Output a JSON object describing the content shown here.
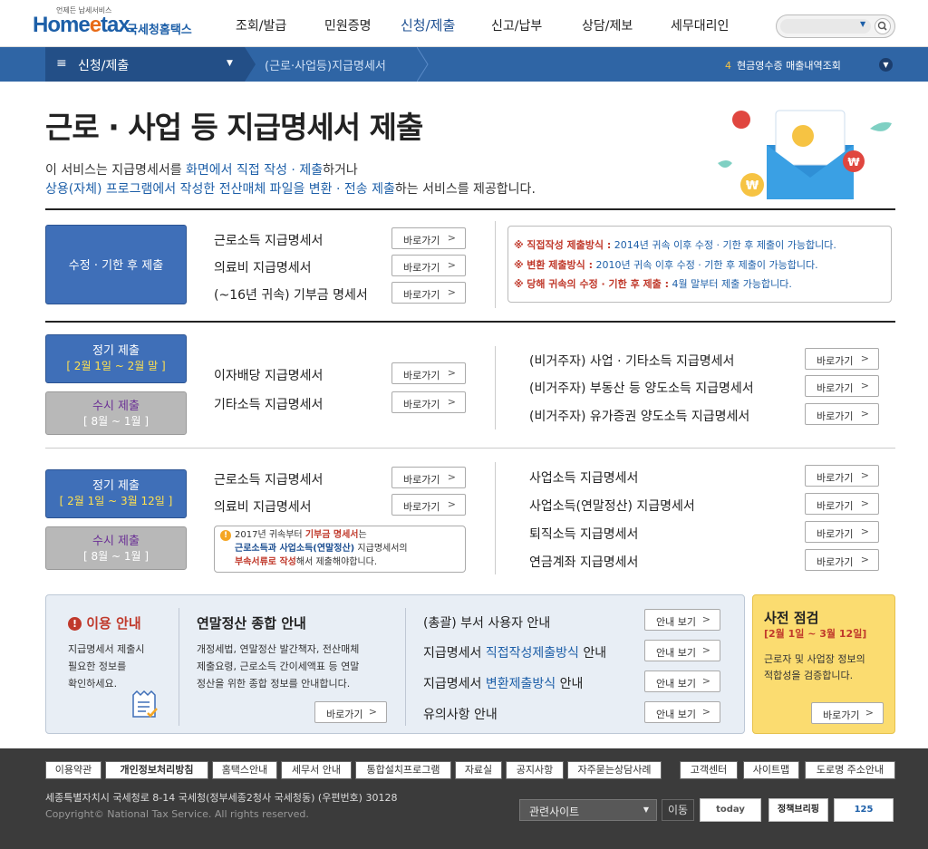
{
  "header": {
    "logo_tag": "언제든 납세서비스",
    "logo_main": "Home",
    "logo_e": "e",
    "logo_tail": "tax.",
    "logo_ko": "국세청홈택스",
    "gnb": [
      "조회/발급",
      "민원증명",
      "신청/제출",
      "신고/납부",
      "상담/제보",
      "세무대리인"
    ]
  },
  "subnav": {
    "menu_label": "신청/제출",
    "breadcrumb": "(근로·사업등)지급명세서",
    "right_num": "4",
    "right_text": "현금영수증 매출내역조회"
  },
  "page": {
    "title": "근로 · 사업 등 지급명세서 제출",
    "intro1_a": "이 서비스는 지급명세서를 ",
    "intro1_b": "화면에서 직접 작성 · 제출",
    "intro1_c": "하거나",
    "intro2_a": "상용(자체) 프로그램에서 작성한 전산매체 파일을 변환 · 전송 제출",
    "intro2_b": "하는 서비스를 제공합니다."
  },
  "go_label": "바로가기",
  "arrow": ">",
  "section1": {
    "box": "수정 · 기한 후 제출",
    "items": [
      "근로소득 지급명세서",
      "의료비 지급명세서",
      "(~16년 귀속) 기부금 명세서"
    ],
    "notices": [
      {
        "mark": "※",
        "label": "직접작성 제출방식 :",
        "text": "2014년 귀속 이후 수정 · 기한 후 제출이 가능합니다."
      },
      {
        "mark": "※",
        "label": "변환 제출방식 :",
        "text": "2010년 귀속 이후 수정 · 기한 후 제출이 가능합니다."
      },
      {
        "mark": "※",
        "label": "당해 귀속의 수정 · 기한 후 제출 :",
        "text": "4월 말부터 제출 가능합니다."
      }
    ]
  },
  "section2": {
    "regular": "정기 제출",
    "regular_period": "[ 2월 1일 ~ 2월 말 ]",
    "adhoc": "수시 제출",
    "adhoc_period": "[ 8월 ~ 1월 ]",
    "items_left": [
      "이자배당 지급명세서",
      "기타소득 지급명세서"
    ],
    "items_right": [
      "(비거주자) 사업 · 기타소득 지급명세서",
      "(비거주자) 부동산 등 양도소득 지급명세서",
      "(비거주자) 유가증권 양도소득 지급명세서"
    ]
  },
  "section3": {
    "regular": "정기 제출",
    "regular_period": "[ 2월 1일 ~ 3월 12일 ]",
    "adhoc": "수시 제출",
    "adhoc_period": "[ 8월 ~ 1월 ]",
    "items_left": [
      "근로소득 지급명세서",
      "의료비 지급명세서"
    ],
    "items_right": [
      "사업소득 지급명세서",
      "사업소득(연말정산) 지급명세서",
      "퇴직소득 지급명세서",
      "연금계좌 지급명세서"
    ],
    "notice": {
      "icon": "!",
      "a": "2017년 귀속부터 ",
      "b": "기부금 명세서",
      "c": "는",
      "d": "근로소득과 사업소득(연말정산)",
      "e": " 지급명세서의",
      "f": "부속서류로 작성",
      "g": "해서 제출해야합니다."
    }
  },
  "info": {
    "usage_title": "이용 안내",
    "usage_icon": "!",
    "usage_text": [
      "지급명세서 제출시",
      "필요한 정보를",
      "확인하세요."
    ],
    "yearend_title": "연말정산 종합 안내",
    "yearend_text": [
      "개정세법, 연말정산 발간책자, 전산매체",
      "제출요령, 근로소득 간이세액표 등 연말",
      "정산을 위한 종합 정보를 안내합니다."
    ],
    "yearend_btn": "바로가기",
    "guides": [
      {
        "a": "(총괄) 부서 사용자 안내",
        "b": "",
        "c": ""
      },
      {
        "a": "지급명세서 ",
        "b": "직접작성제출방식",
        "c": " 안내"
      },
      {
        "a": "지급명세서 ",
        "b": "변환제출방식",
        "c": " 안내"
      },
      {
        "a": "유의사항 안내",
        "b": "",
        "c": ""
      }
    ],
    "guide_btn": "안내 보기"
  },
  "precheck": {
    "title": "사전 점검",
    "period": "[2월 1일 ~ 3월 12일]",
    "text": [
      "근로자 및 사업장 정보의",
      "적합성을 검증합니다."
    ],
    "btn": "바로가기"
  },
  "footer": {
    "links": [
      "이용약관",
      "개인정보처리방침",
      "홈택스안내",
      "세무서 안내",
      "통합설치프로그램",
      "자료실",
      "공지사항",
      "자주묻는상담사례",
      "고객센터",
      "사이트맵",
      "도로명 주소안내"
    ],
    "address": "세종특별자치시 국세청로 8-14 국세청(정부세종2청사 국세청동) (우편번호) 30128",
    "copyright": "Copyright© National Tax Service. All rights reserved.",
    "site_select": "관련사이트",
    "move": "이동",
    "banners": [
      "today",
      "정책브리핑",
      "125"
    ]
  },
  "colors": {
    "brand": "#1d5fa8",
    "subnav": "#2f65a5",
    "box_blue": "#3f6fb8",
    "precheck": "#fbdc70",
    "notice_red": "#c0392b"
  }
}
